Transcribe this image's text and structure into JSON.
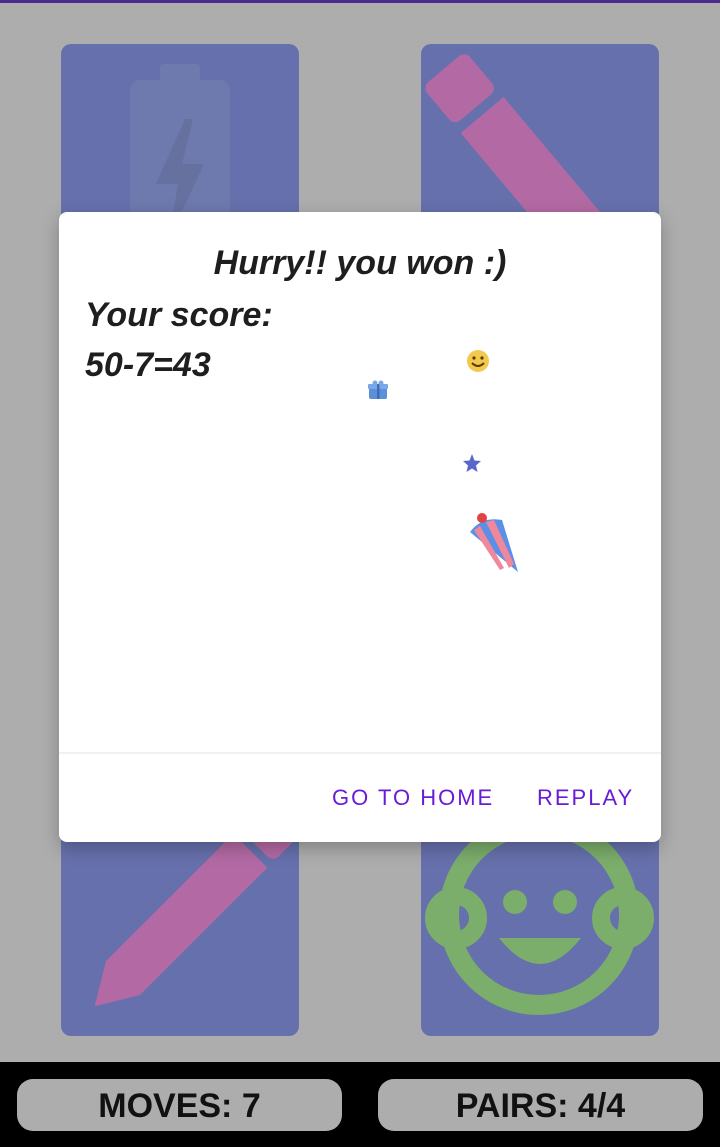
{
  "dialog": {
    "title": "Hurry!! you won :)",
    "score_label": "Your score:",
    "score_value": "50-7=43",
    "go_home_label": "GO TO HOME",
    "replay_label": "REPLAY"
  },
  "board": {
    "cards": [
      {
        "icon": "battery-charging-icon"
      },
      {
        "icon": "pencil-icon"
      },
      {
        "icon": "pencil-icon"
      },
      {
        "icon": "baby-face-icon"
      }
    ]
  },
  "confetti": [
    "smile-emoji-icon",
    "gift-icon",
    "star-icon",
    "party-popper-icon"
  ],
  "status": {
    "moves": "MOVES: 7",
    "pairs": "PAIRS: 4/4"
  },
  "colors": {
    "card": "#6670ac",
    "pencil": "#b36aa4",
    "face": "#7bad6b",
    "accent": "#6a1bd6",
    "overlay": "#adadad"
  }
}
